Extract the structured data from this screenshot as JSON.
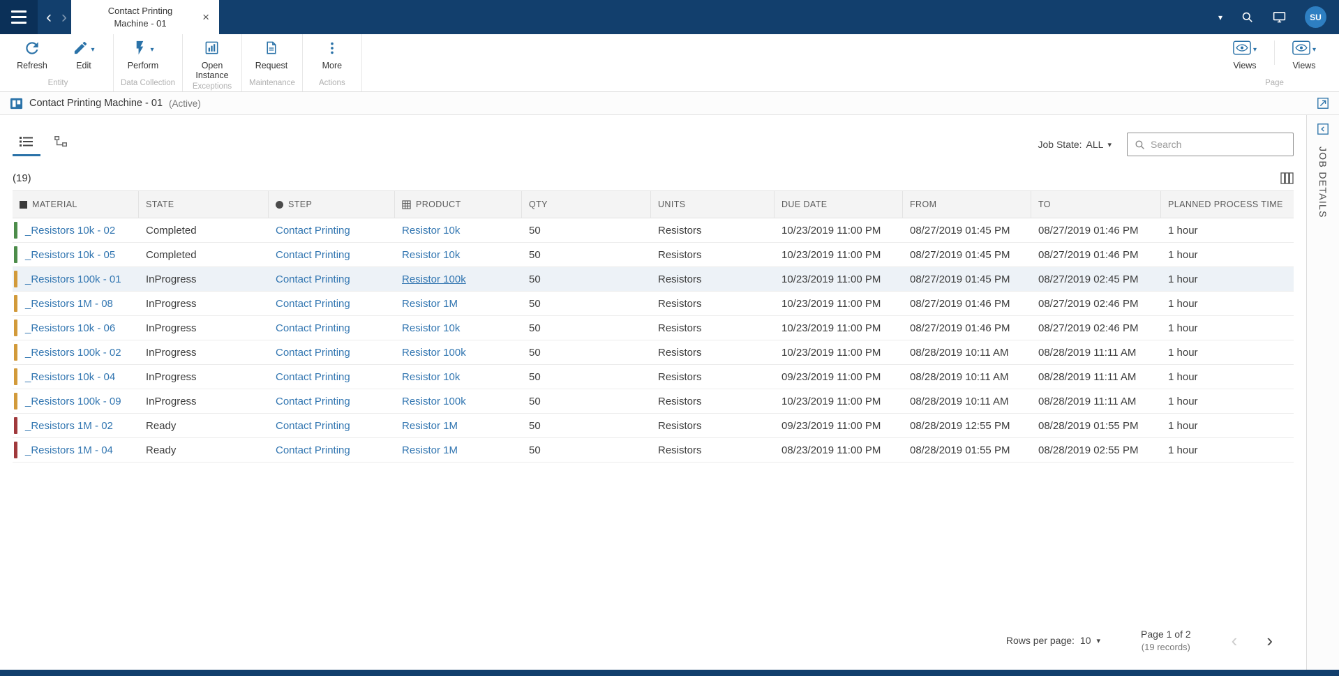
{
  "colors": {
    "topbar": "#123f6d",
    "accent_blue": "#2a72a8",
    "link_blue": "#3276b1"
  },
  "icons": {
    "caret_down": "▾",
    "close": "×",
    "back_chevron": "‹",
    "forward_chevron": "›",
    "page_prev": "‹",
    "page_next": "›"
  },
  "topbar": {
    "tab": {
      "line1": "Contact Printing",
      "line2": "Machine - 01"
    },
    "avatar": "SU"
  },
  "ribbon": {
    "groups": [
      {
        "label": "Entity",
        "buttons": [
          {
            "label": "Refresh"
          },
          {
            "label": "Edit"
          }
        ]
      },
      {
        "label": "Data Collection",
        "buttons": [
          {
            "label": "Perform"
          }
        ]
      },
      {
        "label": "Exceptions",
        "buttons": [
          {
            "label": "Open Instance"
          }
        ]
      },
      {
        "label": "Maintenance",
        "buttons": [
          {
            "label": "Request"
          }
        ]
      },
      {
        "label": "Actions",
        "buttons": [
          {
            "label": "More"
          }
        ]
      }
    ],
    "right_group": {
      "label": "Page",
      "buttons": [
        {
          "label": "Views"
        },
        {
          "label": "Views"
        }
      ]
    }
  },
  "entity_header": {
    "title": "Contact Printing Machine - 01",
    "status": "(Active)"
  },
  "filters": {
    "job_state_label": "Job State:",
    "job_state_value": "ALL",
    "search_placeholder": "Search"
  },
  "record_count": "(19)",
  "table": {
    "columns": [
      "MATERIAL",
      "STATE",
      "STEP",
      "PRODUCT",
      "QTY",
      "UNITS",
      "DUE DATE",
      "FROM",
      "TO",
      "PLANNED PROCESS TIME"
    ],
    "status_colors": {
      "Completed": "#4c8c4a",
      "InProgress": "#d29a3a",
      "Ready": "#a0393c"
    },
    "rows": [
      {
        "material": "_Resistors 10k - 02",
        "state": "Completed",
        "step": "Contact Printing",
        "product": "Resistor 10k",
        "qty": "50",
        "units": "Resistors",
        "due_date": "10/23/2019 11:00 PM",
        "from": "08/27/2019 01:45 PM",
        "to": "08/27/2019 01:46 PM",
        "planned_process_time": "1 hour",
        "selected": false,
        "product_underlined": false
      },
      {
        "material": "_Resistors 10k - 05",
        "state": "Completed",
        "step": "Contact Printing",
        "product": "Resistor 10k",
        "qty": "50",
        "units": "Resistors",
        "due_date": "10/23/2019 11:00 PM",
        "from": "08/27/2019 01:45 PM",
        "to": "08/27/2019 01:46 PM",
        "planned_process_time": "1 hour",
        "selected": false,
        "product_underlined": false
      },
      {
        "material": "_Resistors 100k - 01",
        "state": "InProgress",
        "step": "Contact Printing",
        "product": "Resistor 100k",
        "qty": "50",
        "units": "Resistors",
        "due_date": "10/23/2019 11:00 PM",
        "from": "08/27/2019 01:45 PM",
        "to": "08/27/2019 02:45 PM",
        "planned_process_time": "1 hour",
        "selected": true,
        "product_underlined": true
      },
      {
        "material": "_Resistors 1M - 08",
        "state": "InProgress",
        "step": "Contact Printing",
        "product": "Resistor 1M",
        "qty": "50",
        "units": "Resistors",
        "due_date": "10/23/2019 11:00 PM",
        "from": "08/27/2019 01:46 PM",
        "to": "08/27/2019 02:46 PM",
        "planned_process_time": "1 hour",
        "selected": false,
        "product_underlined": false
      },
      {
        "material": "_Resistors 10k - 06",
        "state": "InProgress",
        "step": "Contact Printing",
        "product": "Resistor 10k",
        "qty": "50",
        "units": "Resistors",
        "due_date": "10/23/2019 11:00 PM",
        "from": "08/27/2019 01:46 PM",
        "to": "08/27/2019 02:46 PM",
        "planned_process_time": "1 hour",
        "selected": false,
        "product_underlined": false
      },
      {
        "material": "_Resistors 100k - 02",
        "state": "InProgress",
        "step": "Contact Printing",
        "product": "Resistor 100k",
        "qty": "50",
        "units": "Resistors",
        "due_date": "10/23/2019 11:00 PM",
        "from": "08/28/2019 10:11 AM",
        "to": "08/28/2019 11:11 AM",
        "planned_process_time": "1 hour",
        "selected": false,
        "product_underlined": false
      },
      {
        "material": "_Resistors 10k - 04",
        "state": "InProgress",
        "step": "Contact Printing",
        "product": "Resistor 10k",
        "qty": "50",
        "units": "Resistors",
        "due_date": "09/23/2019 11:00 PM",
        "from": "08/28/2019 10:11 AM",
        "to": "08/28/2019 11:11 AM",
        "planned_process_time": "1 hour",
        "selected": false,
        "product_underlined": false
      },
      {
        "material": "_Resistors 100k - 09",
        "state": "InProgress",
        "step": "Contact Printing",
        "product": "Resistor 100k",
        "qty": "50",
        "units": "Resistors",
        "due_date": "10/23/2019 11:00 PM",
        "from": "08/28/2019 10:11 AM",
        "to": "08/28/2019 11:11 AM",
        "planned_process_time": "1 hour",
        "selected": false,
        "product_underlined": false
      },
      {
        "material": "_Resistors 1M - 02",
        "state": "Ready",
        "step": "Contact Printing",
        "product": "Resistor 1M",
        "qty": "50",
        "units": "Resistors",
        "due_date": "09/23/2019 11:00 PM",
        "from": "08/28/2019 12:55 PM",
        "to": "08/28/2019 01:55 PM",
        "planned_process_time": "1 hour",
        "selected": false,
        "product_underlined": false
      },
      {
        "material": "_Resistors 1M - 04",
        "state": "Ready",
        "step": "Contact Printing",
        "product": "Resistor 1M",
        "qty": "50",
        "units": "Resistors",
        "due_date": "08/23/2019 11:00 PM",
        "from": "08/28/2019 01:55 PM",
        "to": "08/28/2019 02:55 PM",
        "planned_process_time": "1 hour",
        "selected": false,
        "product_underlined": false
      }
    ]
  },
  "pagination": {
    "rows_per_page_label": "Rows per page:",
    "rows_per_page_value": "10",
    "page_info": "Page 1 of 2",
    "records_info": "(19 records)"
  },
  "side_panel": {
    "title": "JOB DETAILS"
  }
}
